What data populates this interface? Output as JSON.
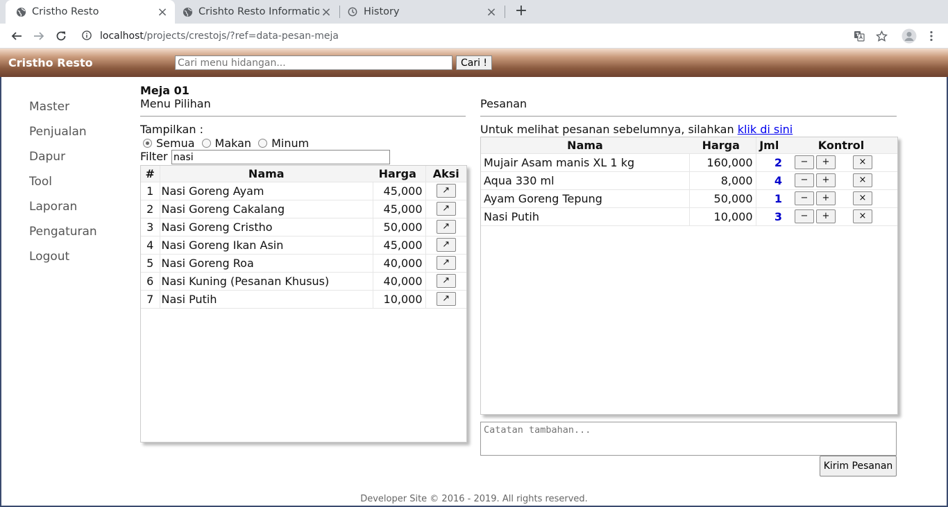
{
  "browser": {
    "tabs": [
      {
        "title": "Cristho Resto"
      },
      {
        "title": "Crishto Resto Information"
      },
      {
        "title": "History"
      }
    ],
    "url_host": "localhost",
    "url_path": "/projects/crestojs/?ref=data-pesan-meja"
  },
  "app": {
    "brand": "Cristho Resto",
    "search_placeholder": "Cari menu hidangan...",
    "search_button": "Cari !"
  },
  "sidebar": {
    "items": [
      {
        "label": "Master"
      },
      {
        "label": "Penjualan"
      },
      {
        "label": "Dapur"
      },
      {
        "label": "Tool"
      },
      {
        "label": "Laporan"
      },
      {
        "label": "Pengaturan"
      },
      {
        "label": "Logout"
      }
    ]
  },
  "menu": {
    "table_title": "Meja 01",
    "heading": "Menu Pilihan",
    "show_label": "Tampilkan :",
    "filter_options": [
      {
        "label": "Semua",
        "selected": true
      },
      {
        "label": "Makan",
        "selected": false
      },
      {
        "label": "Minum",
        "selected": false
      }
    ],
    "filter_label": "Filter",
    "filter_value": "nasi",
    "columns": {
      "num": "#",
      "nama": "Nama",
      "harga": "Harga",
      "aksi": "Aksi"
    },
    "action_glyph": "↗",
    "rows": [
      {
        "num": "1",
        "nama": "Nasi Goreng Ayam",
        "harga": "45,000"
      },
      {
        "num": "2",
        "nama": "Nasi Goreng Cakalang",
        "harga": "45,000"
      },
      {
        "num": "3",
        "nama": "Nasi Goreng Cristho",
        "harga": "50,000"
      },
      {
        "num": "4",
        "nama": "Nasi Goreng Ikan Asin",
        "harga": "45,000"
      },
      {
        "num": "5",
        "nama": "Nasi Goreng Roa",
        "harga": "40,000"
      },
      {
        "num": "6",
        "nama": "Nasi Kuning (Pesanan Khusus)",
        "harga": "40,000"
      },
      {
        "num": "7",
        "nama": "Nasi Putih",
        "harga": "10,000"
      }
    ]
  },
  "order": {
    "heading": "Pesanan",
    "info_text": "Untuk melihat pesanan sebelumnya, silahkan ",
    "info_link": "klik di sini",
    "columns": {
      "nama": "Nama",
      "harga": "Harga",
      "jml": "Jml",
      "kontrol": "Kontrol"
    },
    "controls": {
      "minus": "−",
      "plus": "+",
      "remove": "×"
    },
    "rows": [
      {
        "nama": "Mujair Asam manis XL 1 kg",
        "harga": "160,000",
        "jml": "2"
      },
      {
        "nama": "Aqua 330 ml",
        "harga": "8,000",
        "jml": "4"
      },
      {
        "nama": "Ayam Goreng Tepung",
        "harga": "50,000",
        "jml": "1"
      },
      {
        "nama": "Nasi Putih",
        "harga": "10,000",
        "jml": "3"
      }
    ],
    "notes_placeholder": "Catatan tambahan...",
    "submit_button": "Kirim Pesanan"
  },
  "footer": {
    "text": "Developer Site © 2016 - 2019. All rights reserved."
  }
}
